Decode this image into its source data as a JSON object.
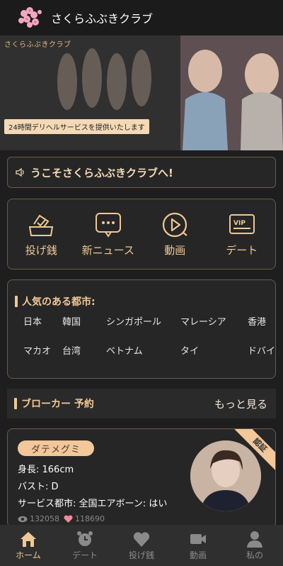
{
  "header": {
    "title": "さくらふぶきクラブ"
  },
  "banner": {
    "brand_text": "さくらふぶきクラブ",
    "tagline": "24時間デリヘルサービスを提供いたします"
  },
  "notice": {
    "text": "うこそさくらふぶきクラブへ!"
  },
  "quick_links": [
    {
      "label": "投げ銭",
      "icon": "tip-box-icon"
    },
    {
      "label": "新ニュース",
      "icon": "chat-bubble-icon"
    },
    {
      "label": "動画",
      "icon": "play-icon"
    },
    {
      "label": "デート",
      "icon": "vip-card-icon"
    }
  ],
  "cities": {
    "title": "人気のある都市:",
    "items": [
      "日本",
      "韓国",
      "シンガポール",
      "マレーシア",
      "香港",
      "マカオ",
      "台湾",
      "ベトナム",
      "タイ",
      "ドバイ"
    ]
  },
  "broker": {
    "title": "ブローカー 予約",
    "more": "もっと見る"
  },
  "card": {
    "name": "ダテメグミ",
    "height": "身長: 166cm",
    "bust": "バスト: D",
    "service": "サービス都市:  全国エアボーン:  はい",
    "views": "132058",
    "likes": "118690",
    "badge": "認証"
  },
  "tabbar": [
    {
      "label": "ホーム",
      "icon": "home-icon",
      "active": true
    },
    {
      "label": "デート",
      "icon": "alarm-clock-icon",
      "active": false
    },
    {
      "label": "投げ銭",
      "icon": "heart-icon",
      "active": false
    },
    {
      "label": "動画",
      "icon": "video-camera-icon",
      "active": false
    },
    {
      "label": "私の",
      "icon": "user-icon",
      "active": false
    }
  ],
  "colors": {
    "accent": "#f0c895",
    "background": "#1e1e1e",
    "card_border": "#6b5a48"
  }
}
